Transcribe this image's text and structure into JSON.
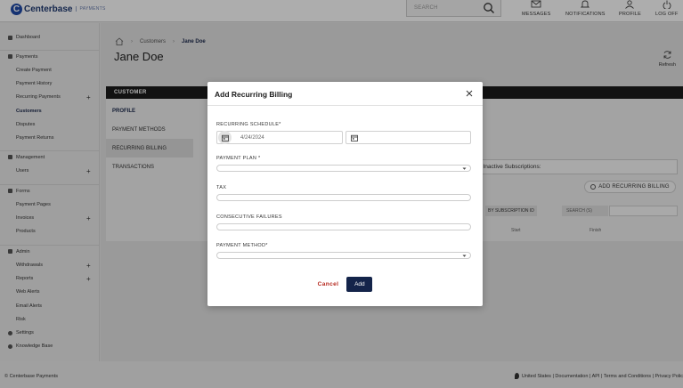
{
  "app": {
    "brand": "Centerbase",
    "brand_sub": "PAYMENTS",
    "search_placeholder": "SEARCH"
  },
  "topnav": [
    {
      "label": "MESSAGES",
      "icon": "envelope-icon"
    },
    {
      "label": "NOTIFICATIONS",
      "icon": "bell-icon"
    },
    {
      "label": "PROFILE",
      "icon": "user-icon"
    },
    {
      "label": "LOG OFF",
      "icon": "logoff-icon"
    }
  ],
  "sidebar": {
    "dashboard": "Dashboard",
    "payments": "Payments",
    "create_payment": "Create Payment",
    "payment_history": "Payment History",
    "recurring_payments": "Recurring Payments",
    "customers": "Customers",
    "disputes": "Disputes",
    "payment_returns": "Payment Returns",
    "management": "Management",
    "users": "Users",
    "forms": "Forms",
    "payment_pages": "Payment Pages",
    "invoices": "Invoices",
    "products": "Products",
    "admin": "Admin",
    "withdrawals": "Withdrawals",
    "reports": "Reports",
    "web_alerts": "Web Alerts",
    "email_alerts": "Email Alerts",
    "risk": "Risk",
    "settings": "Settings",
    "knowledge_base": "Knowledge Base"
  },
  "breadcrumb": {
    "level1": "Customers",
    "current": "Jane Doe"
  },
  "page": {
    "title": "Jane Doe",
    "refresh": "Refresh",
    "section_header": "CUSTOMER",
    "tabs": [
      "PROFILE",
      "PAYMENT METHODS",
      "RECURRING BILLING",
      "TRANSACTIONS"
    ],
    "inactive_subscriptions": "Inactive Subscriptions:",
    "add_recurring_billing": "ADD RECURRING BILLING",
    "filter_by": "BY SUBSCRIPTION ID",
    "search_btn": "SEARCH (S)",
    "columns": [
      "Start",
      "Finish"
    ]
  },
  "footer": {
    "copyright": "© Centerbase Payments",
    "links": "United States | Documentation | API | Terms and Conditions | Privacy Polic"
  },
  "modal": {
    "title": "Add Recurring Billing",
    "recurring_schedule_label": "RECURRING SCHEDULE*",
    "start_date": "4/24/2024",
    "end_date": "",
    "payment_plan_label": "PAYMENT PLAN *",
    "tax_label": "TAX",
    "consecutive_failures_label": "CONSECUTIVE FAILURES",
    "payment_method_label": "PAYMENT METHOD*",
    "cancel": "Cancel",
    "add": "Add"
  }
}
